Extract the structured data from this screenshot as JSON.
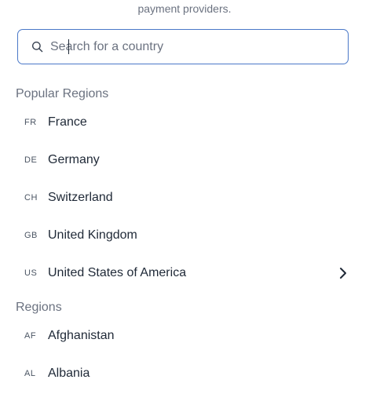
{
  "header": {
    "note_text": "payment providers."
  },
  "search": {
    "placeholder": "Search for a country",
    "value": ""
  },
  "popular": {
    "title": "Popular Regions",
    "items": [
      {
        "code": "FR",
        "name": "France"
      },
      {
        "code": "DE",
        "name": "Germany"
      },
      {
        "code": "CH",
        "name": "Switzerland"
      },
      {
        "code": "GB",
        "name": "United Kingdom"
      },
      {
        "code": "US",
        "name": "United States of America"
      }
    ]
  },
  "regions": {
    "title": "Regions",
    "items": [
      {
        "code": "AF",
        "name": "Afghanistan"
      },
      {
        "code": "AL",
        "name": "Albania"
      }
    ]
  },
  "icons": {
    "search": "search-icon",
    "chevron": "chevron-right-icon"
  },
  "colors": {
    "accent": "#4a78c8",
    "text": "#1f2937",
    "muted": "#6b7280"
  }
}
